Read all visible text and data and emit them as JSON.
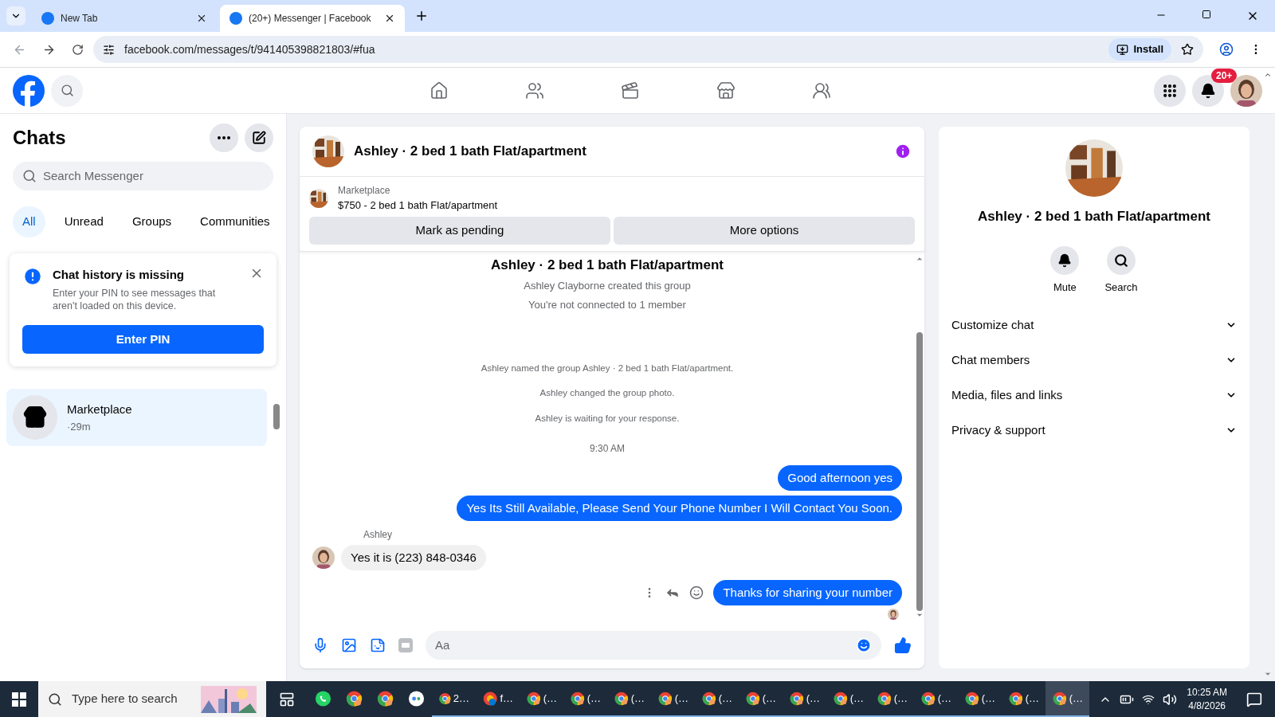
{
  "browser": {
    "tabs": [
      {
        "title": "New Tab",
        "selected": false
      },
      {
        "title": "(20+) Messenger | Facebook",
        "selected": true
      }
    ],
    "url": "facebook.com/messages/t/941405398821803/#fua",
    "install": "Install"
  },
  "header": {
    "badge": "20+",
    "nav": [
      {
        "kind": "home"
      },
      {
        "kind": "friends"
      },
      {
        "kind": "video"
      },
      {
        "kind": "store"
      },
      {
        "kind": "groups"
      }
    ]
  },
  "chats": {
    "title": "Chats",
    "search_placeholder": "Search Messenger",
    "filters": [
      {
        "label": "All",
        "selected": true
      },
      {
        "label": "Unread",
        "selected": false
      },
      {
        "label": "Groups",
        "selected": false
      },
      {
        "label": "Communities",
        "selected": false
      }
    ],
    "notice": {
      "title": "Chat history is missing",
      "body": "Enter your PIN to see messages that aren't loaded on this device.",
      "button": "Enter PIN"
    },
    "conversations": [
      {
        "name": "Marketplace",
        "time": "·29m",
        "selected": true
      }
    ]
  },
  "conversation": {
    "title": "Ashley · 2 bed 1 bath Flat/apartment",
    "listing": {
      "label": "Marketplace",
      "title": "$750 - 2 bed 1 bath Flat/apartment"
    },
    "actions": [
      "Mark as pending",
      "More options"
    ],
    "messages": [
      {
        "kind": "heading",
        "text": "Ashley · 2 bed 1 bath Flat/apartment"
      },
      {
        "kind": "info",
        "text": "Ashley Clayborne created this group"
      },
      {
        "kind": "info",
        "text": "You're not connected to 1 member"
      },
      {
        "kind": "system",
        "text": "Ashley named the group Ashley · 2 bed 1 bath Flat/apartment."
      },
      {
        "kind": "system",
        "text": "Ashley changed the group photo."
      },
      {
        "kind": "system",
        "text": "Ashley is waiting for your response."
      },
      {
        "kind": "time",
        "text": "9:30 AM"
      },
      {
        "kind": "outgoing",
        "text": "Good afternoon yes"
      },
      {
        "kind": "outgoing",
        "text": "Yes Its Still Available, Please Send Your Phone Number I Will Contact You Soon."
      },
      {
        "kind": "incoming",
        "sender": "Ashley",
        "text": "Yes it is (223) 848-0346"
      },
      {
        "kind": "outgoing",
        "text": "Thanks for sharing your number",
        "hovered": true
      }
    ],
    "composer_placeholder": "Aa"
  },
  "details": {
    "title": "Ashley · 2 bed 1 bath Flat/apartment",
    "actions": [
      {
        "kind": "mute",
        "label": "Mute"
      },
      {
        "kind": "search",
        "label": "Search"
      }
    ],
    "sections": [
      {
        "label": "Customize chat"
      },
      {
        "label": "Chat members"
      },
      {
        "label": "Media, files and links"
      },
      {
        "label": "Privacy & support"
      }
    ]
  },
  "taskbar": {
    "search_placeholder": "Type here to search",
    "apps": [
      {
        "kind": "whatsapp"
      },
      {
        "kind": "chrome"
      },
      {
        "kind": "chrome"
      },
      {
        "kind": "dots"
      },
      {
        "kind": "chrome",
        "label": "2…"
      },
      {
        "kind": "skype",
        "label": "f…"
      },
      {
        "kind": "chrome",
        "label": "(…"
      },
      {
        "kind": "chrome",
        "label": "(…"
      },
      {
        "kind": "chrome",
        "label": "(…"
      },
      {
        "kind": "chrome",
        "label": "(…"
      },
      {
        "kind": "chrome",
        "label": "(…"
      },
      {
        "kind": "chrome",
        "label": "(…"
      },
      {
        "kind": "chrome",
        "label": "(…"
      },
      {
        "kind": "chrome",
        "label": "(…"
      },
      {
        "kind": "chrome",
        "label": "(…"
      },
      {
        "kind": "chrome",
        "label": "(…"
      },
      {
        "kind": "chrome",
        "label": "(…"
      },
      {
        "kind": "chrome",
        "label": "(…"
      },
      {
        "kind": "chrome",
        "label": "(…",
        "selected": true
      }
    ],
    "time": "10:25 AM",
    "date": "4/8/2026"
  }
}
